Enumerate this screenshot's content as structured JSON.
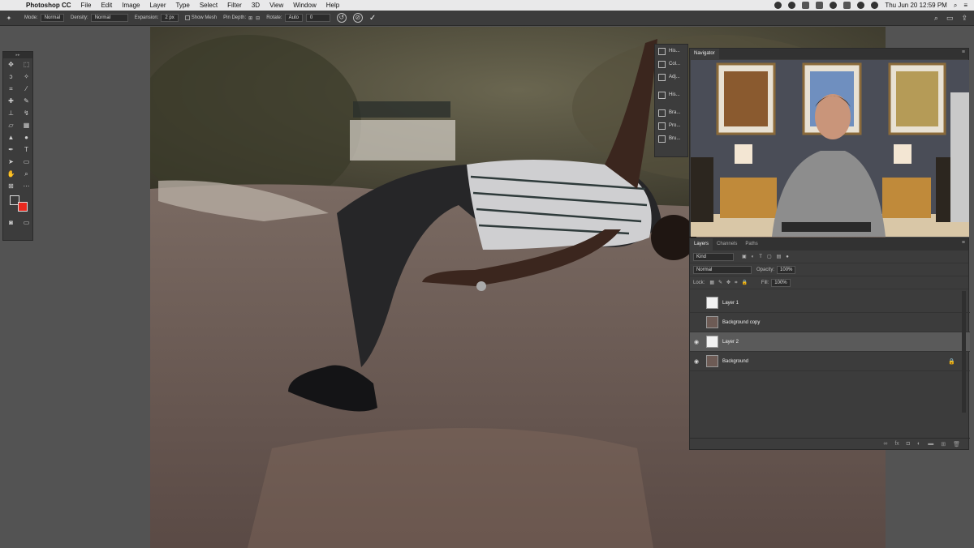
{
  "menubar": {
    "apple": "",
    "app": "Photoshop CC",
    "items": [
      "File",
      "Edit",
      "Image",
      "Layer",
      "Type",
      "Select",
      "Filter",
      "3D",
      "View",
      "Window",
      "Help"
    ],
    "clock": "Thu Jun 20  12:59 PM"
  },
  "options": {
    "mode_label": "Mode:",
    "mode_value": "Normal",
    "density_label": "Density:",
    "density_value": "Normal",
    "expansion_label": "Expansion:",
    "expansion_value": "2 px",
    "show_mesh": "Show Mesh",
    "pin_depth_label": "Pin Depth:",
    "rotate_label": "Rotate:",
    "rotate_value": "Auto",
    "rotate_degrees": "0",
    "commit": "✓"
  },
  "minipanel": {
    "items": [
      "His...",
      "Col...",
      "Adj...",
      "His...",
      "Bra...",
      "Pro...",
      "Bru..."
    ]
  },
  "navigator": {
    "tab": "Navigator"
  },
  "layers": {
    "tabs": [
      "Layers",
      "Channels",
      "Paths"
    ],
    "kind": "Kind",
    "blend": "Normal",
    "opacity_label": "Opacity:",
    "opacity": "100%",
    "lock_label": "Lock:",
    "fill_label": "Fill:",
    "fill": "100%",
    "rows": [
      {
        "name": "Layer 1",
        "visible": false,
        "selected": false
      },
      {
        "name": "Background copy",
        "visible": false,
        "selected": false
      },
      {
        "name": "Layer 2",
        "visible": true,
        "selected": true
      },
      {
        "name": "Background",
        "visible": true,
        "selected": false,
        "locked": true
      }
    ]
  },
  "colors": {
    "foreground": "#3a3a3a",
    "background": "#e8291f"
  }
}
